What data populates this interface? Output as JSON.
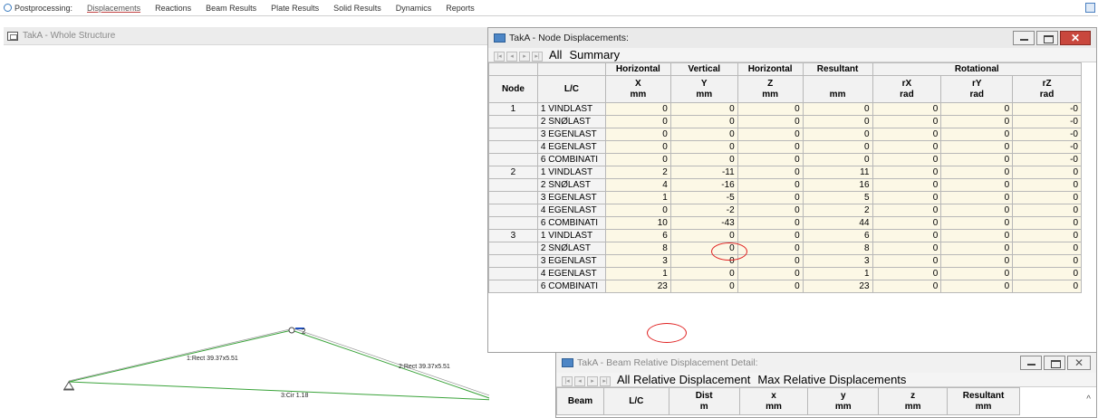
{
  "toolbar": {
    "items": [
      "Postprocessing:",
      "Displacements",
      "Reactions",
      "Beam Results",
      "Plate Results",
      "Solid Results",
      "Dynamics",
      "Reports"
    ],
    "active": "Displacements"
  },
  "left_pane": {
    "title": "TakA - Whole Structure",
    "labels": {
      "node2": "2",
      "beam1": "1:Rect 39.37x5.51",
      "beam2": "2:Rect 39.37x5.51",
      "beam3": "3:Cir 1.18"
    }
  },
  "node_window": {
    "title": "TakA - Node Displacements:",
    "tabs": [
      "All",
      "Summary"
    ],
    "header_groups": [
      "Horizontal",
      "Vertical",
      "Horizontal",
      "Resultant",
      "Rotational"
    ],
    "columns": [
      {
        "name": "Node",
        "unit": ""
      },
      {
        "name": "L/C",
        "unit": ""
      },
      {
        "name": "X",
        "unit": "mm"
      },
      {
        "name": "Y",
        "unit": "mm"
      },
      {
        "name": "Z",
        "unit": "mm"
      },
      {
        "name": "",
        "unit": "mm"
      },
      {
        "name": "rX",
        "unit": "rad"
      },
      {
        "name": "rY",
        "unit": "rad"
      },
      {
        "name": "rZ",
        "unit": "rad"
      }
    ],
    "rows": [
      {
        "node": "1",
        "lc": "1 VINDLAST",
        "x": "0",
        "y": "0",
        "z": "0",
        "r": "0",
        "rx": "0",
        "ry": "0",
        "rz": "-0"
      },
      {
        "node": "",
        "lc": "2 SNØLAST",
        "x": "0",
        "y": "0",
        "z": "0",
        "r": "0",
        "rx": "0",
        "ry": "0",
        "rz": "-0"
      },
      {
        "node": "",
        "lc": "3 EGENLAST",
        "x": "0",
        "y": "0",
        "z": "0",
        "r": "0",
        "rx": "0",
        "ry": "0",
        "rz": "-0"
      },
      {
        "node": "",
        "lc": "4  EGENLAST",
        "x": "0",
        "y": "0",
        "z": "0",
        "r": "0",
        "rx": "0",
        "ry": "0",
        "rz": "-0"
      },
      {
        "node": "",
        "lc": "6 COMBINATI",
        "x": "0",
        "y": "0",
        "z": "0",
        "r": "0",
        "rx": "0",
        "ry": "0",
        "rz": "-0"
      },
      {
        "node": "2",
        "lc": "1 VINDLAST",
        "x": "2",
        "y": "-11",
        "z": "0",
        "r": "11",
        "rx": "0",
        "ry": "0",
        "rz": "0"
      },
      {
        "node": "",
        "lc": "2 SNØLAST",
        "x": "4",
        "y": "-16",
        "z": "0",
        "r": "16",
        "rx": "0",
        "ry": "0",
        "rz": "0"
      },
      {
        "node": "",
        "lc": "3 EGENLAST",
        "x": "1",
        "y": "-5",
        "z": "0",
        "r": "5",
        "rx": "0",
        "ry": "0",
        "rz": "0"
      },
      {
        "node": "",
        "lc": "4  EGENLAST",
        "x": "0",
        "y": "-2",
        "z": "0",
        "r": "2",
        "rx": "0",
        "ry": "0",
        "rz": "0"
      },
      {
        "node": "",
        "lc": "6 COMBINATI",
        "x": "10",
        "y": "-43",
        "z": "0",
        "r": "44",
        "rx": "0",
        "ry": "0",
        "rz": "0"
      },
      {
        "node": "3",
        "lc": "1 VINDLAST",
        "x": "6",
        "y": "0",
        "z": "0",
        "r": "6",
        "rx": "0",
        "ry": "0",
        "rz": "0"
      },
      {
        "node": "",
        "lc": "2 SNØLAST",
        "x": "8",
        "y": "0",
        "z": "0",
        "r": "8",
        "rx": "0",
        "ry": "0",
        "rz": "0"
      },
      {
        "node": "",
        "lc": "3 EGENLAST",
        "x": "3",
        "y": "0",
        "z": "0",
        "r": "3",
        "rx": "0",
        "ry": "0",
        "rz": "0"
      },
      {
        "node": "",
        "lc": "4  EGENLAST",
        "x": "1",
        "y": "0",
        "z": "0",
        "r": "1",
        "rx": "0",
        "ry": "0",
        "rz": "0"
      },
      {
        "node": "",
        "lc": "6 COMBINATI",
        "x": "23",
        "y": "0",
        "z": "0",
        "r": "23",
        "rx": "0",
        "ry": "0",
        "rz": "0"
      }
    ]
  },
  "beam_window": {
    "title": "TakA - Beam Relative Displacement Detail:",
    "tabs": [
      "All Relative Displacement",
      "Max Relative Displacements"
    ],
    "columns": [
      {
        "name": "Beam",
        "unit": ""
      },
      {
        "name": "L/C",
        "unit": ""
      },
      {
        "name": "Dist",
        "unit": "m"
      },
      {
        "name": "x",
        "unit": "mm"
      },
      {
        "name": "y",
        "unit": "mm"
      },
      {
        "name": "z",
        "unit": "mm"
      },
      {
        "name": "Resultant",
        "unit": "mm"
      }
    ]
  },
  "colors": {
    "annotation_circle": "#e02020",
    "structure_line": "#3aa33a",
    "cell_bg": "#fcf8e6"
  }
}
